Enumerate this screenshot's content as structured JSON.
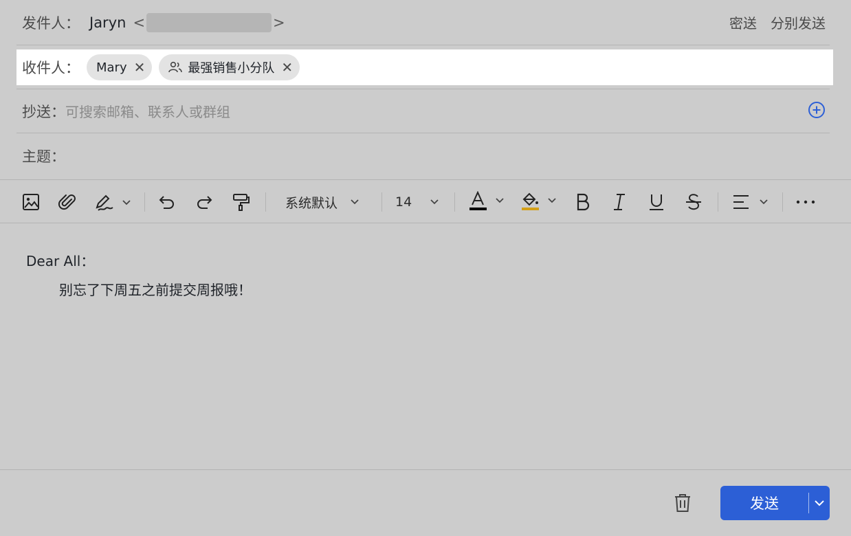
{
  "header": {
    "from_label": "发件人：",
    "sender_name": "Jaryn",
    "angle_open": "<",
    "angle_close": ">",
    "bcc_label": "密送",
    "separate_send_label": "分别发送"
  },
  "to": {
    "label": "收件人：",
    "recipients": [
      {
        "name": "Mary",
        "type": "person"
      },
      {
        "name": "最强销售小分队",
        "type": "group"
      }
    ]
  },
  "cc": {
    "label": "抄送：",
    "placeholder": "可搜索邮箱、联系人或群组"
  },
  "subject": {
    "label": "主题：",
    "value": ""
  },
  "toolbar": {
    "font_family": "系统默认",
    "font_size": "14",
    "text_color": "#000000",
    "highlight_color": "#d4a017"
  },
  "body": {
    "greeting": "Dear All：",
    "text": "别忘了下周五之前提交周报哦！"
  },
  "footer": {
    "send_label": "发送"
  },
  "colors": {
    "accent": "#2c5fd6",
    "background": "#cccccc"
  }
}
